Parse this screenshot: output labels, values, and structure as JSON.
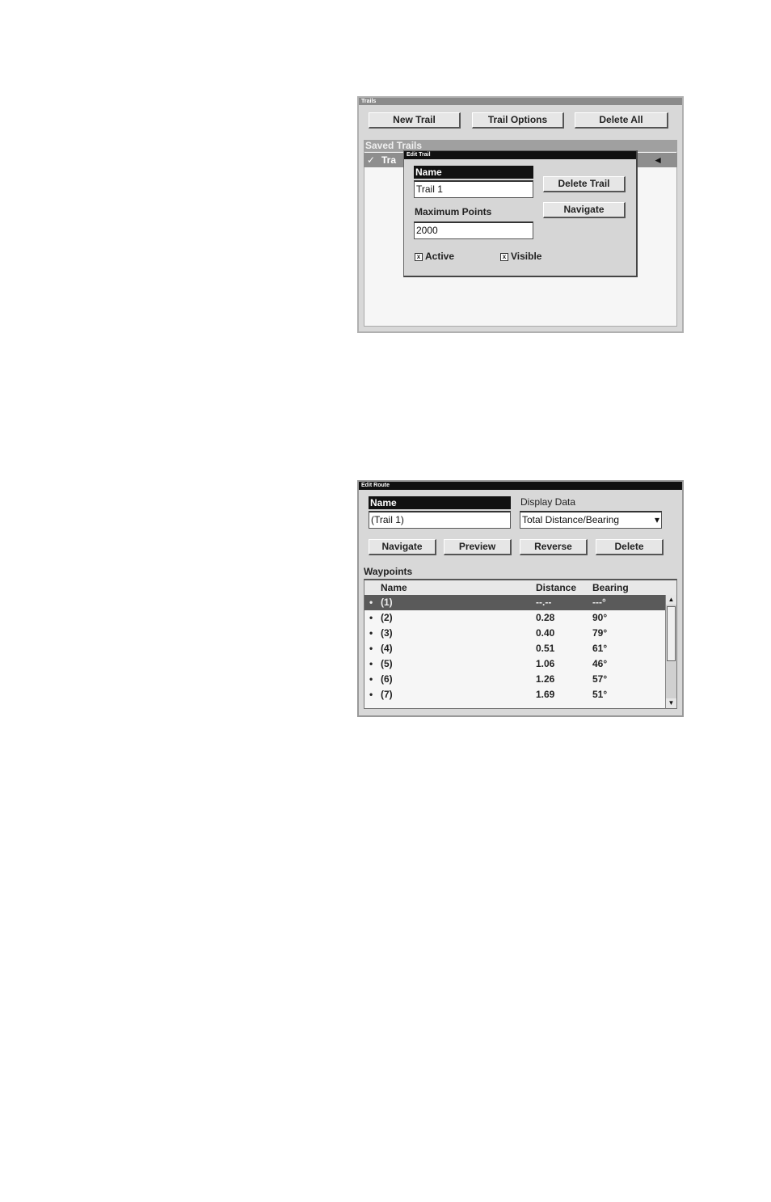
{
  "trails_window": {
    "title": "Trails",
    "new_trail": "New Trail",
    "trail_options": "Trail Options",
    "delete_all": "Delete All",
    "saved_trails_label": "Saved Trails",
    "trail_item_check": "✓",
    "trail_item_label": "Tra",
    "arrow": "◄"
  },
  "edit_trail": {
    "title": "Edit Trail",
    "name_label": "Name",
    "name_value": "Trail 1",
    "max_points_label": "Maximum Points",
    "max_points_value": "2000",
    "delete_trail": "Delete Trail",
    "navigate": "Navigate",
    "active_label": "Active",
    "visible_label": "Visible",
    "checkbox_mark": "x"
  },
  "edit_route": {
    "title": "Edit Route",
    "name_label": "Name",
    "name_value": "(Trail 1)",
    "display_data_label": "Display Data",
    "display_data_value": "Total Distance/Bearing",
    "dropdown_arrow": "▾",
    "buttons": {
      "navigate": "Navigate",
      "preview": "Preview",
      "reverse": "Reverse",
      "delete": "Delete"
    },
    "waypoints_label": "Waypoints",
    "columns": {
      "name": "Name",
      "distance": "Distance",
      "bearing": "Bearing"
    },
    "rows": [
      {
        "bullet": "•",
        "name": "(1)",
        "distance": "--.--",
        "bearing": "---°"
      },
      {
        "bullet": "•",
        "name": "(2)",
        "distance": "0.28",
        "bearing": "90°"
      },
      {
        "bullet": "•",
        "name": "(3)",
        "distance": "0.40",
        "bearing": "79°"
      },
      {
        "bullet": "•",
        "name": "(4)",
        "distance": "0.51",
        "bearing": "61°"
      },
      {
        "bullet": "•",
        "name": "(5)",
        "distance": "1.06",
        "bearing": "46°"
      },
      {
        "bullet": "•",
        "name": "(6)",
        "distance": "1.26",
        "bearing": "57°"
      },
      {
        "bullet": "•",
        "name": "(7)",
        "distance": "1.69",
        "bearing": "51°"
      }
    ],
    "scroll_up": "▲",
    "scroll_down": "▼"
  }
}
